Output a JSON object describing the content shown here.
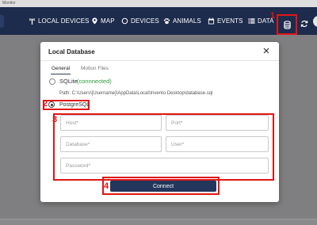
{
  "window": {
    "title": "Monitor"
  },
  "nav": {
    "items": [
      {
        "label": "LOCAL DEVICES",
        "icon": "antenna-icon"
      },
      {
        "label": "MAP",
        "icon": "map-pin-icon"
      },
      {
        "label": "DEVICES",
        "icon": "device-ring-icon"
      },
      {
        "label": "ANIMALS",
        "icon": "paw-icon"
      },
      {
        "label": "EVENTS",
        "icon": "calendar-icon"
      },
      {
        "label": "DATA",
        "icon": "list-icon"
      }
    ],
    "database_icon": "database-icon",
    "sync_icon": "sync-icon"
  },
  "modal": {
    "title": "Local Database",
    "tabs": [
      {
        "label": "General",
        "active": true
      },
      {
        "label": "Motion Files",
        "active": false
      }
    ],
    "sqlite": {
      "label": "SQLite",
      "status": "(connnected)",
      "path": "Path: C:\\Users\\[Username]\\AppData\\Local\\Invento Desktop\\database.sql",
      "selected": false
    },
    "postgres": {
      "label": "PostgreSQL",
      "selected": true
    },
    "fields": {
      "host_placeholder": "Host*",
      "port_placeholder": "Port*",
      "database_placeholder": "Database*",
      "user_placeholder": "User*",
      "password_placeholder": "Password*"
    },
    "connect_label": "Connect"
  },
  "markers": {
    "m1": "1",
    "m2": "2",
    "m3": "3",
    "m4": "4"
  },
  "colors": {
    "navbar": "#1d2b4c",
    "accent": "#24365c",
    "highlight": "#e01616",
    "connected": "#2e9a3a"
  }
}
